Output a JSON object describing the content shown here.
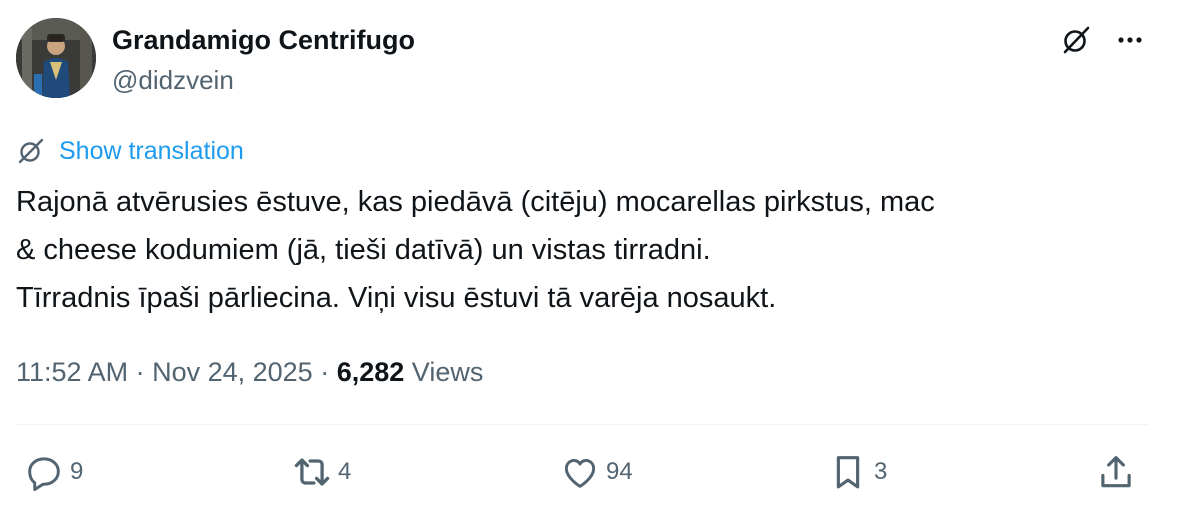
{
  "author": {
    "display_name": "Grandamigo Centrifugo",
    "handle": "@didzvein",
    "avatar_icon": "user-avatar-photo"
  },
  "header_icons": {
    "grok": "grok-icon",
    "more": "more-icon"
  },
  "translation": {
    "icon": "globe-icon",
    "label": "Show translation"
  },
  "tweet": {
    "lines": [
      "Rajonā atvērusies ēstuve, kas piedāvā (citēju) mocarellas pirkstus, mac",
      "& cheese kodumiem (jā, tieši datīvā) un vistas tirradni.",
      "Tīrradnis īpaši pārliecina. Viņi visu ēstuvi tā varēja nosaukt."
    ]
  },
  "meta": {
    "time": "11:52 AM",
    "separator": " · ",
    "date": "Nov 24, 2025",
    "views_count": "6,282",
    "views_label": "Views"
  },
  "actions": {
    "reply": {
      "icon": "reply-icon",
      "count": "9"
    },
    "repost": {
      "icon": "repost-icon",
      "count": "4"
    },
    "like": {
      "icon": "heart-icon",
      "count": "94"
    },
    "bookmark": {
      "icon": "bookmark-icon",
      "count": "3"
    },
    "share": {
      "icon": "share-icon"
    }
  },
  "colors": {
    "link": "#1d9bf0",
    "secondary_text": "#536471",
    "primary_text": "#0f1419",
    "divider": "#eff3f4"
  }
}
